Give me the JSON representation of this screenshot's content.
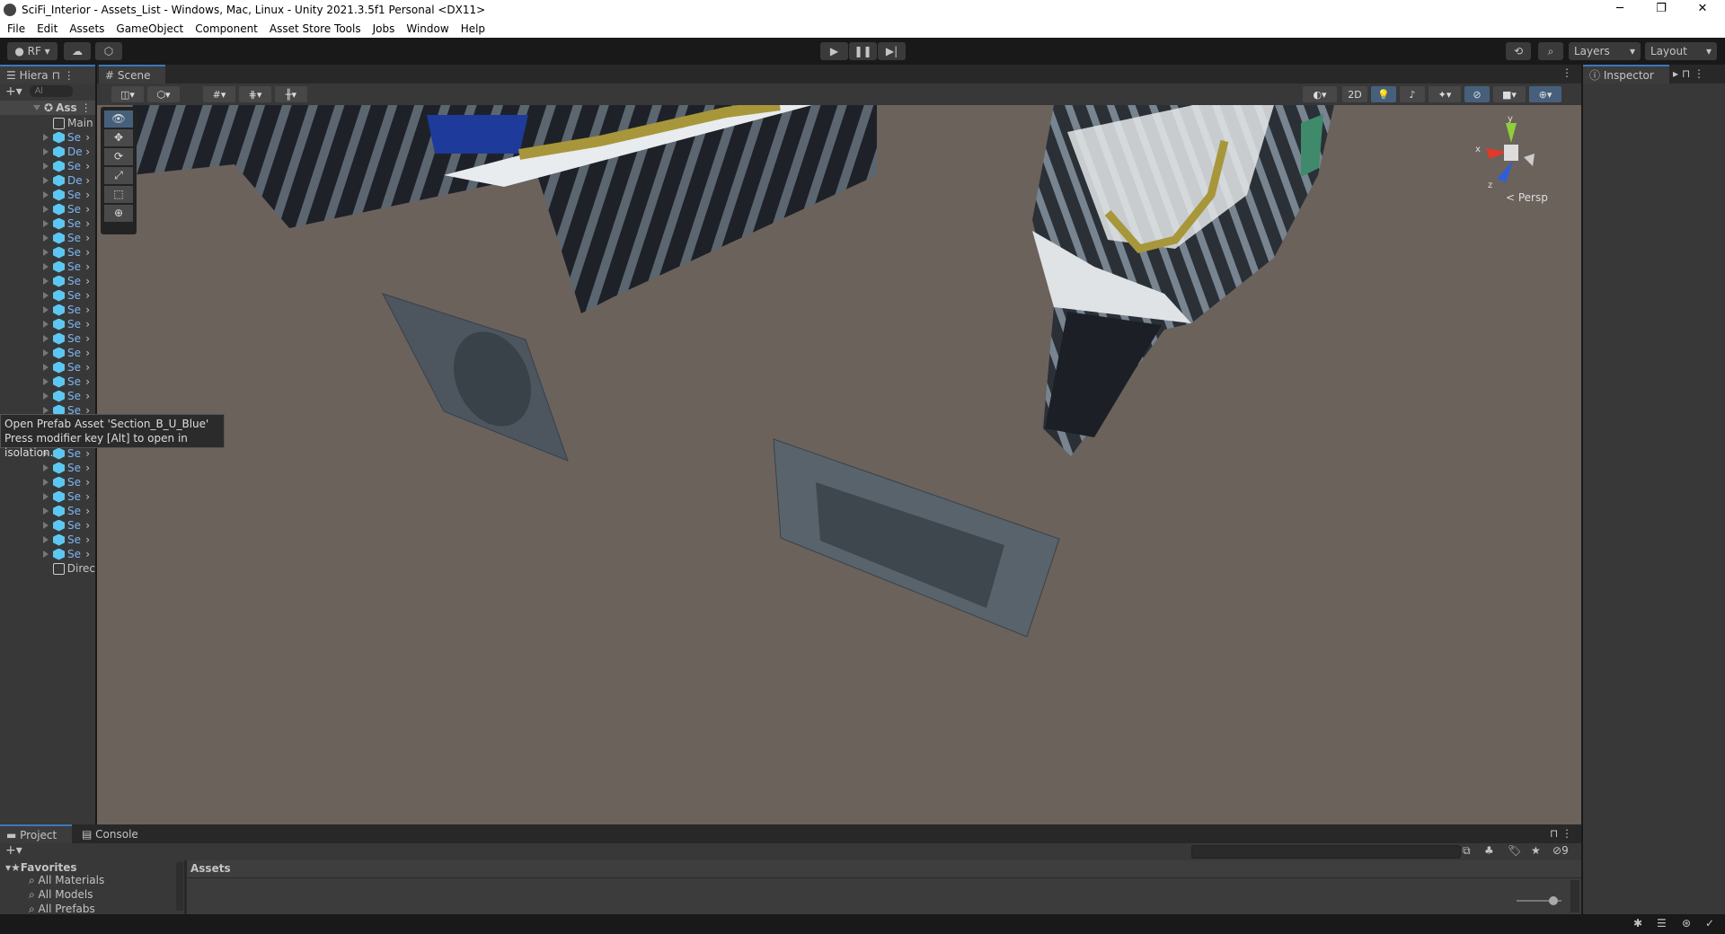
{
  "window": {
    "title": "SciFi_Interior - Assets_List - Windows, Mac, Linux - Unity 2021.3.5f1 Personal <DX11>",
    "minimize": "─",
    "restore": "❐",
    "close": "✕"
  },
  "menu": [
    "File",
    "Edit",
    "Assets",
    "GameObject",
    "Component",
    "Asset Store Tools",
    "Jobs",
    "Window",
    "Help"
  ],
  "toolbar": {
    "account": "RF ▾",
    "layers": "Layers",
    "layout": "Layout",
    "play": "▶",
    "pause": "❚❚",
    "step": "▶|"
  },
  "hierarchy": {
    "tab": "Hiera",
    "search_placeholder": "Al",
    "root": "Ass",
    "items": [
      {
        "name": "Main",
        "type": "object"
      },
      {
        "name": "Se",
        "type": "prefab"
      },
      {
        "name": "De",
        "type": "prefab"
      },
      {
        "name": "Se",
        "type": "prefab"
      },
      {
        "name": "De",
        "type": "prefab"
      },
      {
        "name": "Se",
        "type": "prefab"
      },
      {
        "name": "Se",
        "type": "prefab"
      },
      {
        "name": "Se",
        "type": "prefab"
      },
      {
        "name": "Se",
        "type": "prefab"
      },
      {
        "name": "Se",
        "type": "prefab"
      },
      {
        "name": "Se",
        "type": "prefab"
      },
      {
        "name": "Se",
        "type": "prefab"
      },
      {
        "name": "Se",
        "type": "prefab"
      },
      {
        "name": "Se",
        "type": "prefab"
      },
      {
        "name": "Se",
        "type": "prefab"
      },
      {
        "name": "Se",
        "type": "prefab"
      },
      {
        "name": "Se",
        "type": "prefab"
      },
      {
        "name": "Se",
        "type": "prefab"
      },
      {
        "name": "Se",
        "type": "prefab"
      },
      {
        "name": "Se",
        "type": "prefab"
      },
      {
        "name": "Se",
        "type": "prefab"
      },
      {
        "name": "Se",
        "type": "prefab"
      },
      {
        "name": "Se",
        "type": "prefab"
      },
      {
        "name": "Se",
        "type": "prefab"
      },
      {
        "name": "Se",
        "type": "prefab"
      },
      {
        "name": "Se",
        "type": "prefab"
      },
      {
        "name": "Se",
        "type": "prefab"
      },
      {
        "name": "Se",
        "type": "prefab"
      },
      {
        "name": "Se",
        "type": "prefab"
      },
      {
        "name": "Se",
        "type": "prefab"
      },
      {
        "name": "Se",
        "type": "prefab"
      },
      {
        "name": "Direc",
        "type": "object"
      }
    ]
  },
  "tooltip": {
    "line1": "Open Prefab Asset 'Section_B_U_Blue'",
    "line2": "Press modifier key [Alt] to open in isolation."
  },
  "scene": {
    "tab": "Scene",
    "btn_2d": "2D",
    "persp": "< Persp",
    "axis_x": "x",
    "axis_y": "y",
    "axis_z": "z"
  },
  "inspector": {
    "tab": "Inspector"
  },
  "project": {
    "tab_project": "Project",
    "tab_console": "Console",
    "favorites": "Favorites",
    "fav_items": [
      "All Materials",
      "All Models",
      "All Prefabs"
    ],
    "breadcrumb": "Assets",
    "hidden_count": "9"
  },
  "colors": {
    "accent": "#3a79bb",
    "scene_bg": "#6b625c",
    "prefab": "#5cc8f2"
  }
}
